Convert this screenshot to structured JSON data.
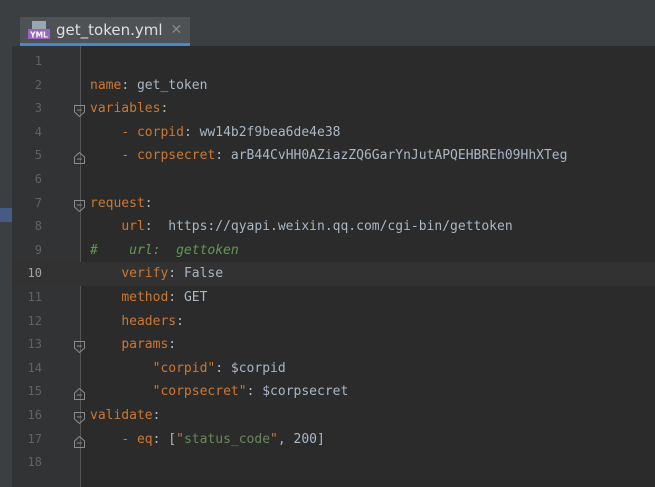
{
  "tab": {
    "label": "get_token.yml",
    "icon": "yml-file-icon",
    "icon_text": "YML"
  },
  "colors": {
    "key": "#cc7832",
    "value": "#a9b7c6",
    "string": "#6a8759",
    "comment": "#629755",
    "background": "#2b2b2b"
  },
  "current_line": 10,
  "lines": [
    {
      "n": "1",
      "key": "",
      "sep": "",
      "val": "",
      "indent": ""
    },
    {
      "n": "2",
      "indent": "",
      "key": "name",
      "sep": ": ",
      "val": "get_token"
    },
    {
      "n": "3",
      "indent": "",
      "key": "variables",
      "sep": ":",
      "val": ""
    },
    {
      "n": "4",
      "indent": "    - ",
      "key": "corpid",
      "sep": ": ",
      "val": "ww14b2f9bea6de4e38"
    },
    {
      "n": "5",
      "indent": "    - ",
      "key": "corpsecret",
      "sep": ": ",
      "val": "arB44CvHH0AZiazZQ6GarYnJutAPQEHBREh09HhXTeg"
    },
    {
      "n": "6",
      "indent": "",
      "key": "",
      "sep": "",
      "val": ""
    },
    {
      "n": "7",
      "indent": "",
      "key": "request",
      "sep": ":",
      "val": ""
    },
    {
      "n": "8",
      "indent": "    ",
      "key": "url",
      "sep": ":  ",
      "val": "https://qyapi.weixin.qq.com/cgi-bin/gettoken"
    },
    {
      "n": "9",
      "comment": "#    url:  gettoken"
    },
    {
      "n": "10",
      "indent": "    ",
      "key": "verify",
      "sep": ": ",
      "val": "False"
    },
    {
      "n": "11",
      "indent": "    ",
      "key": "method",
      "sep": ": ",
      "val": "GET"
    },
    {
      "n": "12",
      "indent": "    ",
      "key": "headers",
      "sep": ":",
      "val": ""
    },
    {
      "n": "13",
      "indent": "    ",
      "key": "params",
      "sep": ":",
      "val": ""
    },
    {
      "n": "14",
      "indent": "        ",
      "skey": "\"corpid\"",
      "sep": ": ",
      "val": "$corpid"
    },
    {
      "n": "15",
      "indent": "        ",
      "skey": "\"corpsecret\"",
      "sep": ": ",
      "val": "$corpsecret"
    },
    {
      "n": "16",
      "indent": "",
      "key": "validate",
      "sep": ":",
      "val": ""
    },
    {
      "n": "17",
      "indent": "    - ",
      "key": "eq",
      "sep": ": [",
      "sval": "\"status_code\"",
      "tail": ", 200]"
    },
    {
      "n": "18",
      "indent": "",
      "key": "",
      "sep": "",
      "val": ""
    }
  ]
}
